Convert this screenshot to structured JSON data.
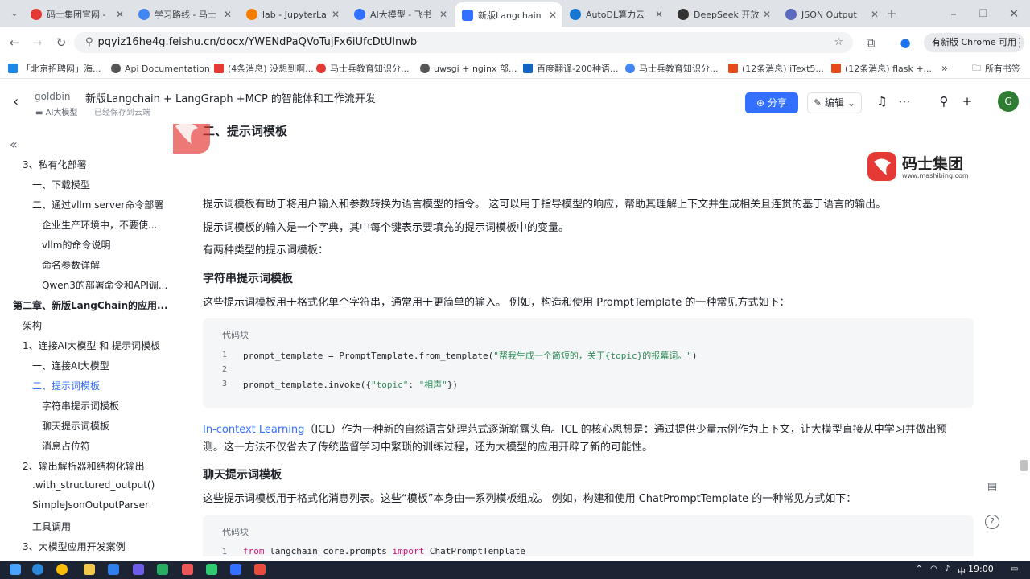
{
  "browser": {
    "tabs": [
      {
        "label": "码士集团官网 -",
        "color": "#e53935"
      },
      {
        "label": "学习路线 - 马士",
        "color": "#4285f4"
      },
      {
        "label": "lab - JupyterLa",
        "color": "#f57c00"
      },
      {
        "label": "AI大模型 - 飞书",
        "color": "#3370ff"
      },
      {
        "label": "新版Langchain",
        "color": "#3370ff"
      },
      {
        "label": "AutoDL算力云",
        "color": "#1976d2"
      },
      {
        "label": "DeepSeek 开放",
        "color": "#333333"
      },
      {
        "label": "JSON Output",
        "color": "#5c6bc0"
      }
    ],
    "url": "pqyiz16he4g.feishu.cn/docx/YWENdPaQVoTujFx6iUfcDtUlnwb",
    "update_button": "有新版 Chrome 可用",
    "bookmarks": [
      {
        "label": "「北京招聘网」海...",
        "color": "#1e88e5"
      },
      {
        "label": "Api Documentation",
        "color": "#555555"
      },
      {
        "label": "(4条消息) 没想到啊...",
        "color": "#e53935"
      },
      {
        "label": "马士兵教育知识分...",
        "color": "#e53935"
      },
      {
        "label": "uwsgi + nginx 部...",
        "color": "#555555"
      },
      {
        "label": "百度翻译-200种语...",
        "color": "#1565c0"
      },
      {
        "label": "马士兵教育知识分...",
        "color": "#4285f4"
      },
      {
        "label": "(12条消息) iText5...",
        "color": "#e64a19"
      },
      {
        "label": "(12条消息) flask +...",
        "color": "#e64a19"
      }
    ],
    "more_bookmarks": "»",
    "all_bookmarks": "所有书签"
  },
  "doc_header": {
    "author": "goldbin",
    "title": "新版Langchain + LangGraph +MCP 的智能体和工作流开发",
    "folder": "AI大模型",
    "saved_status": "已经保存到云端",
    "share_label": "分享",
    "edit_label": "编辑",
    "avatar_letter": "G"
  },
  "sidebar": {
    "items": [
      {
        "label": "3、私有化部署"
      },
      {
        "label": "一、下载模型"
      },
      {
        "label": "二、通过vllm server命令部署"
      },
      {
        "label": "企业生产环境中，不要使..."
      },
      {
        "label": "vllm的命令说明"
      },
      {
        "label": "命名参数详解"
      },
      {
        "label": "Qwen3的部署命令和API调..."
      },
      {
        "label": "第二章、新版LangChain的应用..."
      },
      {
        "label": "架构"
      },
      {
        "label": "1、连接AI大模型 和 提示词模板"
      },
      {
        "label": "一、连接AI大模型"
      },
      {
        "label": "二、提示词模板"
      },
      {
        "label": "字符串提示词模板"
      },
      {
        "label": "聊天提示词模板"
      },
      {
        "label": "消息占位符"
      },
      {
        "label": "2、输出解析器和结构化输出"
      },
      {
        "label": ".with_structured_output()"
      },
      {
        "label": "SimpleJsonOutputParser"
      },
      {
        "label": "工具调用"
      },
      {
        "label": "3、大模型应用开发案例"
      }
    ]
  },
  "content": {
    "section_heading": "二、提示词模板",
    "logo_name": "码士集团",
    "logo_url": "www.mashibing.com",
    "para1": "提示词模板有助于将用户输入和参数转换为语言模型的指令。 这可以用于指导模型的响应，帮助其理解上下文并生成相关且连贯的基于语言的输出。",
    "para2": "提示词模板的输入是一个字典，其中每个键表示要填充的提示词模板中的变量。",
    "para3": "有两种类型的提示词模板：",
    "h_string": "字符串提示词模板",
    "para4": "这些提示词模板用于格式化单个字符串，通常用于更简单的输入。 例如，构造和使用 PromptTemplate 的一种常见方式如下：",
    "code1_label": "代码块",
    "code1": {
      "l1_a": "prompt_template = PromptTemplate.from_template(",
      "l1_b": "\"帮我生成一个简短的，关于{topic}的报幕词。\"",
      "l1_c": ")",
      "l3_a": "prompt_template.invoke({",
      "l3_b": "\"topic\"",
      "l3_c": ": ",
      "l3_d": "\"相声\"",
      "l3_e": "})"
    },
    "icl_link": "In-context Learning",
    "icl_text1": "（ICL）作为一种新的自然语言处理范式逐渐崭露头角。ICL 的核心思想是：通过提供少量示例作为上下文，让大模型直接从中学习并做出预",
    "icl_text2": "测。这一方法不仅省去了传统监督学习中繁琐的训练过程，还为大模型的应用开辟了新的可能性。",
    "h_chat": "聊天提示词模板",
    "para5": "这些提示词模板用于格式化消息列表。这些“模板”本身由一系列模板组成。 例如，构建和使用 ChatPromptTemplate 的一种常见方式如下：",
    "code2_label": "代码块",
    "code2": {
      "kw_from": "from",
      "module": " langchain_core.prompts ",
      "kw_import": "import",
      "name": " ChatPromptTemplate"
    }
  },
  "taskbar": {
    "time": "19:00",
    "ime": "中"
  }
}
